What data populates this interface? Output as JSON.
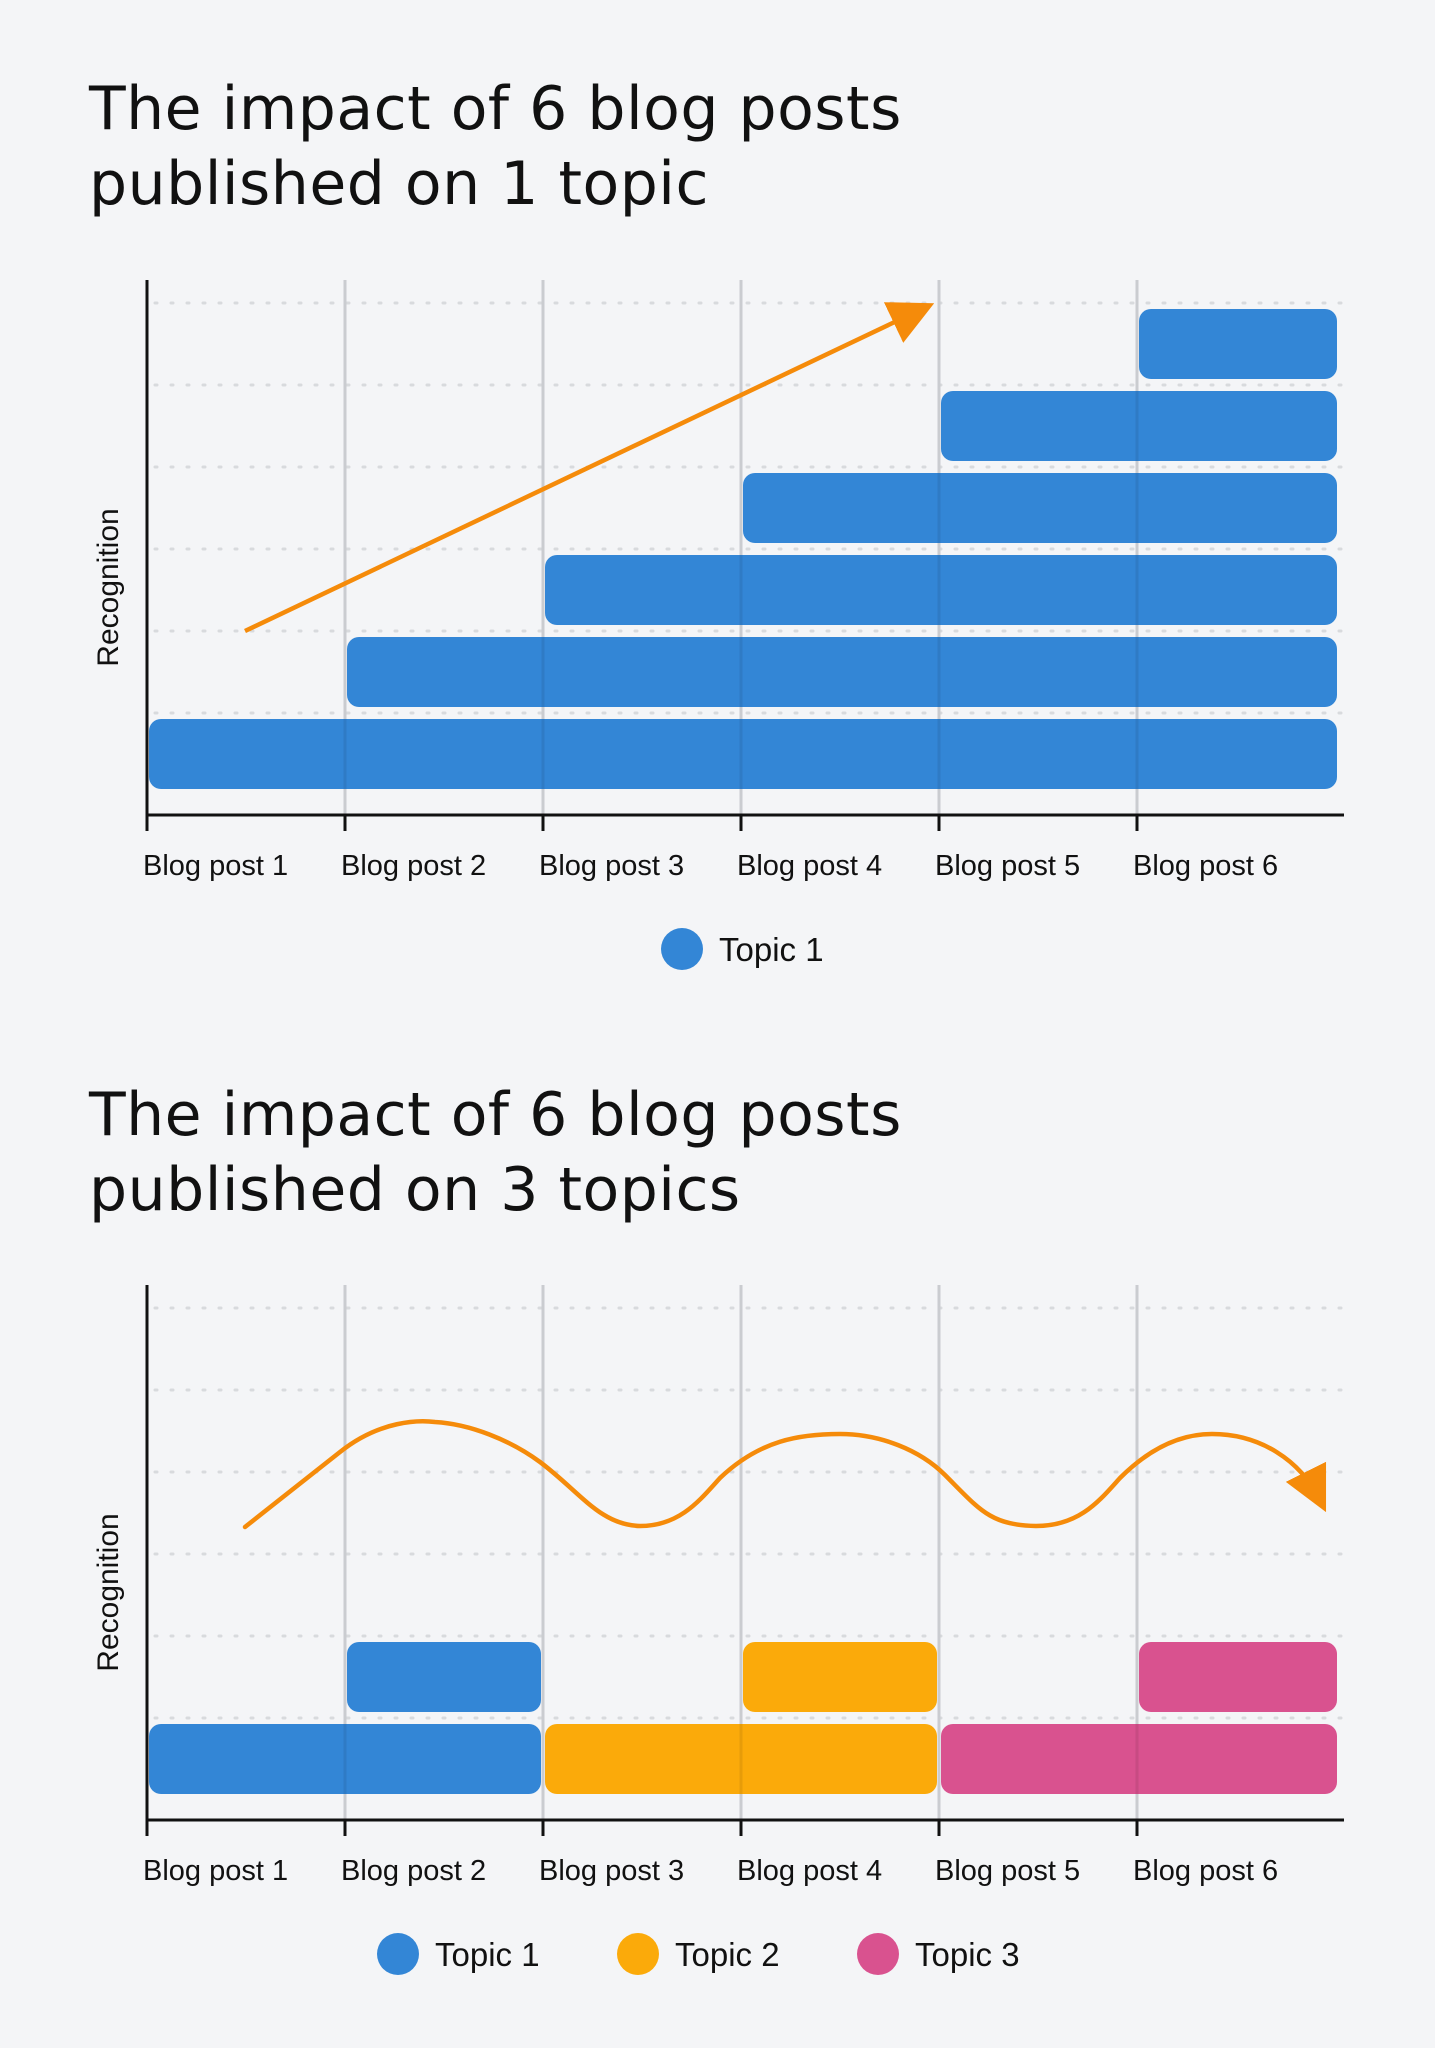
{
  "colors": {
    "topic1": "#3386d6",
    "topic2": "#fbaa0a",
    "topic3": "#d9528f",
    "arrow": "#f58b0a",
    "axis": "#111111",
    "grid": "#dcdee2"
  },
  "chart_data": [
    {
      "type": "bar",
      "subtype": "stacked-timeline",
      "title": "The impact of 6 blog posts published on 1 topic",
      "title_lines": [
        "The impact of 6 blog posts",
        "published on 1 topic"
      ],
      "xlabel": "",
      "ylabel": "Recognition",
      "categories": [
        "Blog post 1",
        "Blog post 2",
        "Blog post 3",
        "Blog post 4",
        "Blog post 5",
        "Blog post 6"
      ],
      "grid": true,
      "legend": [
        {
          "name": "Topic 1",
          "color": "#3386d6"
        }
      ],
      "legend_position": "bottom",
      "bars": [
        {
          "series": "Topic 1",
          "level": 1,
          "start": 1,
          "end": 6
        },
        {
          "series": "Topic 1",
          "level": 2,
          "start": 2,
          "end": 6
        },
        {
          "series": "Topic 1",
          "level": 3,
          "start": 3,
          "end": 6
        },
        {
          "series": "Topic 1",
          "level": 4,
          "start": 4,
          "end": 6
        },
        {
          "series": "Topic 1",
          "level": 5,
          "start": 5,
          "end": 6
        },
        {
          "series": "Topic 1",
          "level": 6,
          "start": 6,
          "end": 6
        }
      ],
      "annotation": {
        "type": "arrow",
        "shape": "straight",
        "from": [
          1.5,
          2
        ],
        "to": [
          5,
          6
        ],
        "meaning": "recognition rises steadily"
      }
    },
    {
      "type": "bar",
      "subtype": "stacked-timeline",
      "title": "The impact of 6 blog posts published on 3 topics",
      "title_lines": [
        "The impact of 6 blog posts",
        "published on 3 topics"
      ],
      "xlabel": "",
      "ylabel": "Recognition",
      "categories": [
        "Blog post 1",
        "Blog post 2",
        "Blog post 3",
        "Blog post 4",
        "Blog post 5",
        "Blog post 6"
      ],
      "grid": true,
      "legend": [
        {
          "name": "Topic 1",
          "color": "#3386d6"
        },
        {
          "name": "Topic 2",
          "color": "#fbaa0a"
        },
        {
          "name": "Topic 3",
          "color": "#d9528f"
        }
      ],
      "legend_position": "bottom",
      "bars": [
        {
          "series": "Topic 1",
          "level": 1,
          "start": 1,
          "end": 2
        },
        {
          "series": "Topic 1",
          "level": 2,
          "start": 2,
          "end": 2
        },
        {
          "series": "Topic 2",
          "level": 1,
          "start": 3,
          "end": 4
        },
        {
          "series": "Topic 2",
          "level": 2,
          "start": 4,
          "end": 4
        },
        {
          "series": "Topic 3",
          "level": 1,
          "start": 5,
          "end": 6
        },
        {
          "series": "Topic 3",
          "level": 2,
          "start": 6,
          "end": 6
        }
      ],
      "annotation": {
        "type": "arrow",
        "shape": "wave",
        "meaning": "recognition rises and falls with each topic switch"
      }
    }
  ]
}
